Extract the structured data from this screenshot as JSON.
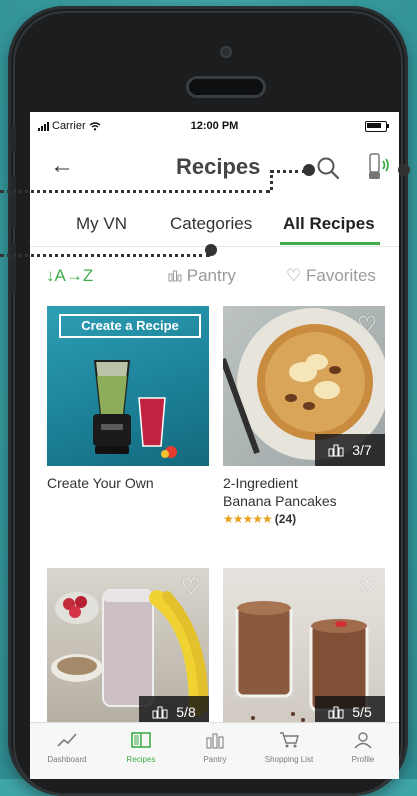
{
  "status_bar": {
    "carrier": "Carrier",
    "time": "12:00 PM"
  },
  "header": {
    "title": "Recipes"
  },
  "tabs": [
    {
      "label": "My VN"
    },
    {
      "label": "Categories"
    },
    {
      "label": "All Recipes",
      "active": true
    }
  ],
  "filters": {
    "sort": "↓A→Z",
    "pantry": "Pantry",
    "favorites": "Favorites"
  },
  "cards": [
    {
      "banner": "Create a Recipe",
      "caption": "Create Your Own"
    },
    {
      "caption_line1": "2-Ingredient",
      "caption_line2": "Banana Pancakes",
      "stars": "★★★★★",
      "rating_count": "(24)",
      "count": "3/7"
    },
    {
      "count": "5/8"
    },
    {
      "count": "5/5"
    }
  ],
  "tabbar": [
    {
      "label": "Dashboard",
      "icon": "chart-line-icon"
    },
    {
      "label": "Recipes",
      "icon": "book-icon",
      "active": true
    },
    {
      "label": "Pantry",
      "icon": "pantry-icon"
    },
    {
      "label": "Shopping List",
      "icon": "cart-icon"
    },
    {
      "label": "Profile",
      "icon": "person-icon"
    }
  ],
  "colors": {
    "accent_green": "#3fae4a",
    "teal_background": "#3fa5a8",
    "annotation_dots": "#333333"
  }
}
